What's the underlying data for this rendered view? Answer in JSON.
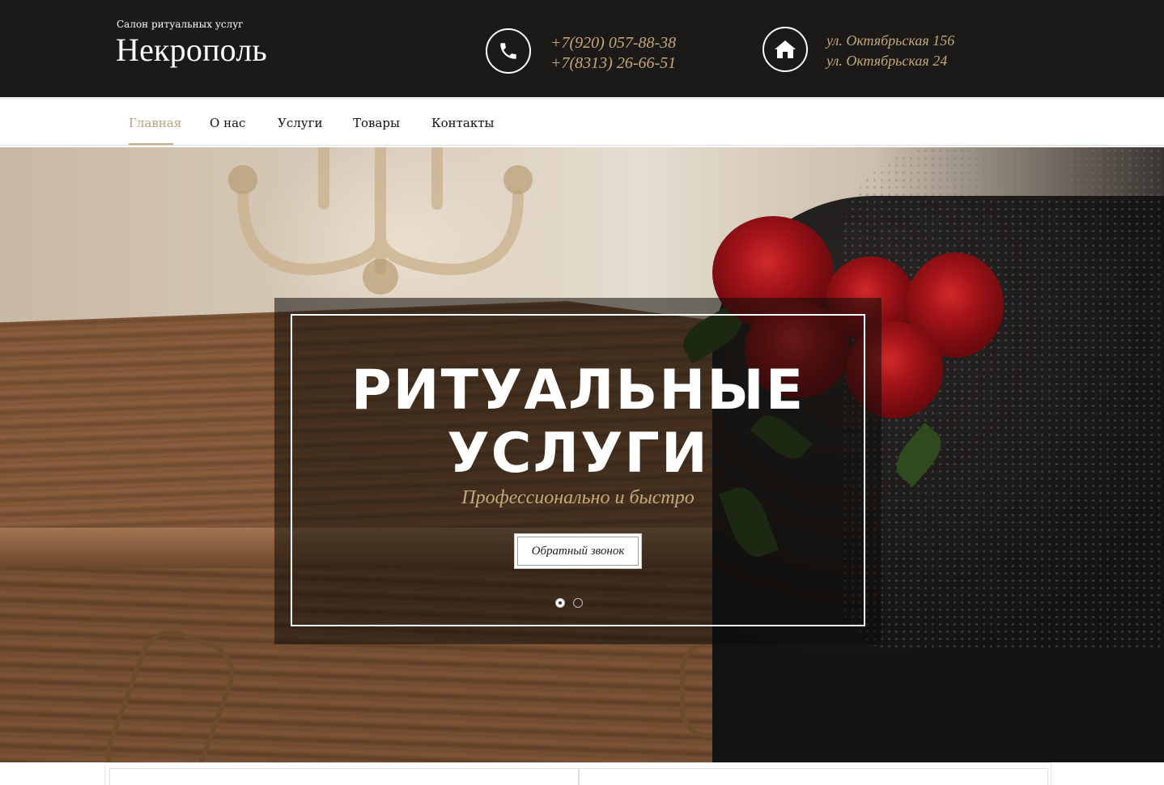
{
  "header": {
    "brand_subtitle": "Салон ритуальных услуг",
    "brand_name": "Некрополь",
    "phones": [
      "+7(920) 057-88-38",
      "+7(8313) 26-66-51"
    ],
    "addresses": [
      "ул. Октябрьская 156",
      "ул. Октябрьская 24"
    ],
    "accent_color": "#c6a878",
    "icons": [
      "phone-icon",
      "home-icon"
    ]
  },
  "nav": {
    "items": [
      {
        "label": "Главная",
        "active": true
      },
      {
        "label": "О нас",
        "active": false
      },
      {
        "label": "Услуги",
        "active": false
      },
      {
        "label": "Товары",
        "active": false
      },
      {
        "label": "Контакты",
        "active": false
      }
    ],
    "active_color": "#b9a27a"
  },
  "hero": {
    "title_line1": "РИТУАЛЬНЫЕ",
    "title_line2": "УСЛУГИ",
    "subtitle": "Профессионально и быстро",
    "cta_label": "Обратный звонок",
    "slides_count": 2,
    "active_slide": 1
  }
}
